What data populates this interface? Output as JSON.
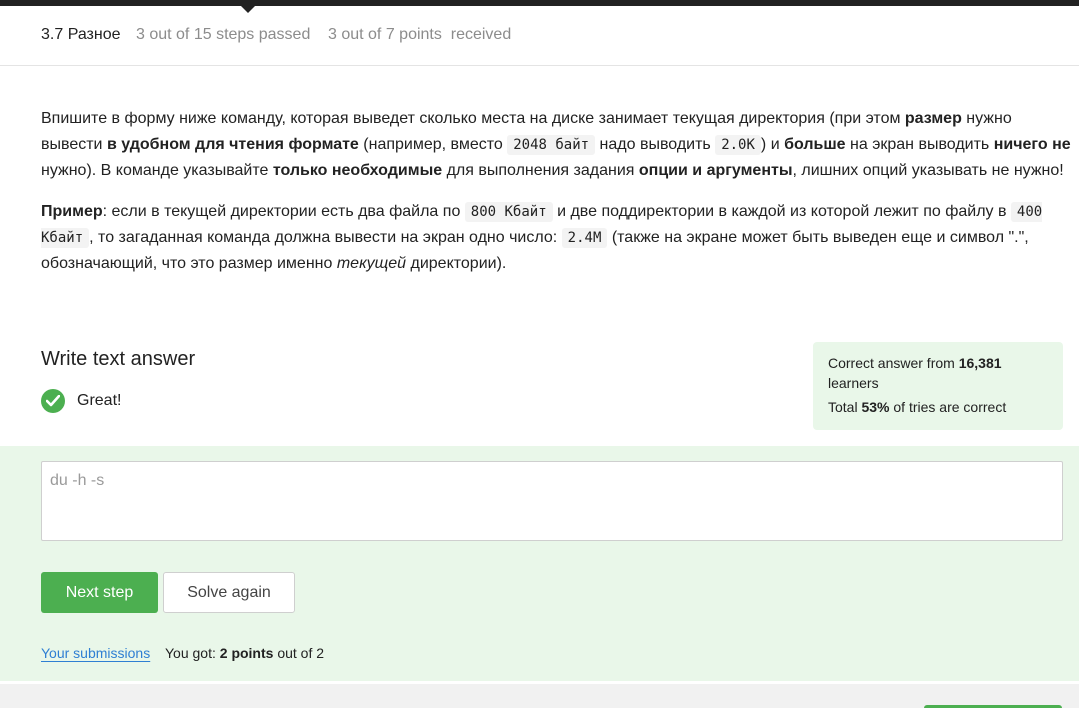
{
  "header": {
    "lesson": "3.7 Разное",
    "steps_progress": "3 out of 15 steps passed",
    "points_progress": "3 out of 7 points  received"
  },
  "task": {
    "p1": {
      "t1": "Впишите в форму ниже команду, которая выведет сколько места на диске занимает текущая директория (при этом ",
      "b1": "размер",
      "t2": " нужно вывести ",
      "b2": "в удобном для чтения формате",
      "t3": " (например, вместо ",
      "c1": "2048 байт",
      "t4": " надо выводить ",
      "c2": "2.0K",
      "t5": ") и ",
      "b3": "больше",
      "t6": " на экран выводить ",
      "b4": "ничего не",
      "t7": " нужно). В команде указывайте ",
      "b5": "только необходимые",
      "t8": " для выполнения задания ",
      "b6": "опции и аргументы",
      "t9": ", лишних опций указывать не нужно!"
    },
    "p2": {
      "b1": "Пример",
      "t1": ": если в текущей директории есть два файла по ",
      "c1": "800 Кбайт",
      "t2": " и две поддиректории в каждой из которой лежит по файлу в ",
      "c2": "400 Кбайт",
      "t3": ", то загаданная команда должна вывести на экран одно число: ",
      "c3": "2.4M",
      "t4": " (также на экране может быть выведен еще и символ \".\", обозначающий, что это размер именно ",
      "i1": "текущей",
      "t5": " директории)."
    }
  },
  "answer": {
    "title": "Write text answer",
    "status": "Great!",
    "value": "du -h -s"
  },
  "stats": {
    "line1_prefix": "Correct answer from ",
    "learners_count": "16,381",
    "line1_suffix": " learners",
    "line2_prefix": "Total ",
    "percent": "53%",
    "line2_suffix": " of tries are correct"
  },
  "buttons": {
    "next": "Next step",
    "solve_again": "Solve again"
  },
  "submission": {
    "link": "Your submissions",
    "got_prefix": "You got: ",
    "points": "2 points",
    "got_suffix": " out of 2"
  },
  "colors": {
    "accent": "#4caf50",
    "success_bg": "#e9f7e9",
    "link": "#2f7fd3"
  }
}
